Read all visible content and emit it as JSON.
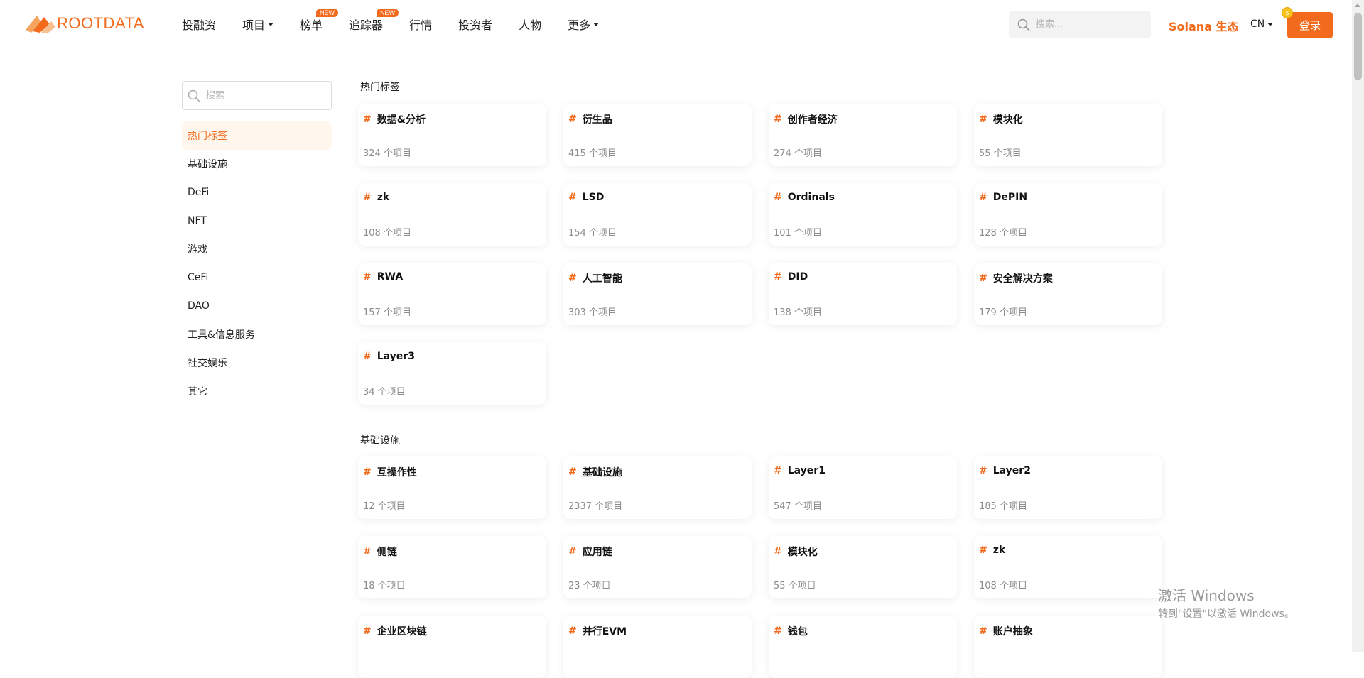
{
  "header": {
    "logo_text": "ROOTDATA",
    "nav": [
      {
        "label": "投融资",
        "caret": false,
        "badge": ""
      },
      {
        "label": "项目",
        "caret": true,
        "badge": ""
      },
      {
        "label": "榜单",
        "caret": false,
        "badge": "NEW"
      },
      {
        "label": "追踪器",
        "caret": false,
        "badge": "NEW"
      },
      {
        "label": "行情",
        "caret": false,
        "badge": ""
      },
      {
        "label": "投资者",
        "caret": false,
        "badge": ""
      },
      {
        "label": "人物",
        "caret": false,
        "badge": ""
      },
      {
        "label": "更多",
        "caret": true,
        "badge": ""
      }
    ],
    "search_placeholder": "搜索...",
    "solana_link": "Solana 生态",
    "lang": "CN",
    "login": "登录",
    "coin": "$"
  },
  "sidebar": {
    "search_placeholder": "搜索",
    "items": [
      {
        "label": "热门标签",
        "active": true
      },
      {
        "label": "基础设施",
        "active": false
      },
      {
        "label": "DeFi",
        "active": false
      },
      {
        "label": "NFT",
        "active": false
      },
      {
        "label": "游戏",
        "active": false
      },
      {
        "label": "CeFi",
        "active": false
      },
      {
        "label": "DAO",
        "active": false
      },
      {
        "label": "工具&信息服务",
        "active": false
      },
      {
        "label": "社交娱乐",
        "active": false
      },
      {
        "label": "其它",
        "active": false
      }
    ]
  },
  "sections": [
    {
      "title": "热门标签",
      "cards": [
        {
          "name": "数据&分析",
          "count": "324 个项目"
        },
        {
          "name": "衍生品",
          "count": "415 个项目"
        },
        {
          "name": "创作者经济",
          "count": "274 个项目"
        },
        {
          "name": "模块化",
          "count": "55 个项目"
        },
        {
          "name": "zk",
          "count": "108 个项目"
        },
        {
          "name": "LSD",
          "count": "154 个项目"
        },
        {
          "name": "Ordinals",
          "count": "101 个项目"
        },
        {
          "name": "DePIN",
          "count": "128 个项目"
        },
        {
          "name": "RWA",
          "count": "157 个项目"
        },
        {
          "name": "人工智能",
          "count": "303 个项目"
        },
        {
          "name": "DID",
          "count": "138 个项目"
        },
        {
          "name": "安全解决方案",
          "count": "179 个项目"
        },
        {
          "name": "Layer3",
          "count": "34 个项目"
        }
      ]
    },
    {
      "title": "基础设施",
      "cards": [
        {
          "name": "互操作性",
          "count": "12 个项目"
        },
        {
          "name": "基础设施",
          "count": "2337 个项目"
        },
        {
          "name": "Layer1",
          "count": "547 个项目"
        },
        {
          "name": "Layer2",
          "count": "185 个项目"
        },
        {
          "name": "侧链",
          "count": "18 个项目"
        },
        {
          "name": "应用链",
          "count": "23 个项目"
        },
        {
          "name": "模块化",
          "count": "55 个项目"
        },
        {
          "name": "zk",
          "count": "108 个项目"
        },
        {
          "name": "企业区块链",
          "count": ""
        },
        {
          "name": "并行EVM",
          "count": ""
        },
        {
          "name": "钱包",
          "count": ""
        },
        {
          "name": "账户抽象",
          "count": ""
        }
      ]
    }
  ],
  "watermark": {
    "title": "激活 Windows",
    "subtitle": "转到\"设置\"以激活 Windows。"
  },
  "colors": {
    "accent": "#f26b1d",
    "active_bg": "#fff6ee",
    "muted_text": "#8c8c8c"
  }
}
